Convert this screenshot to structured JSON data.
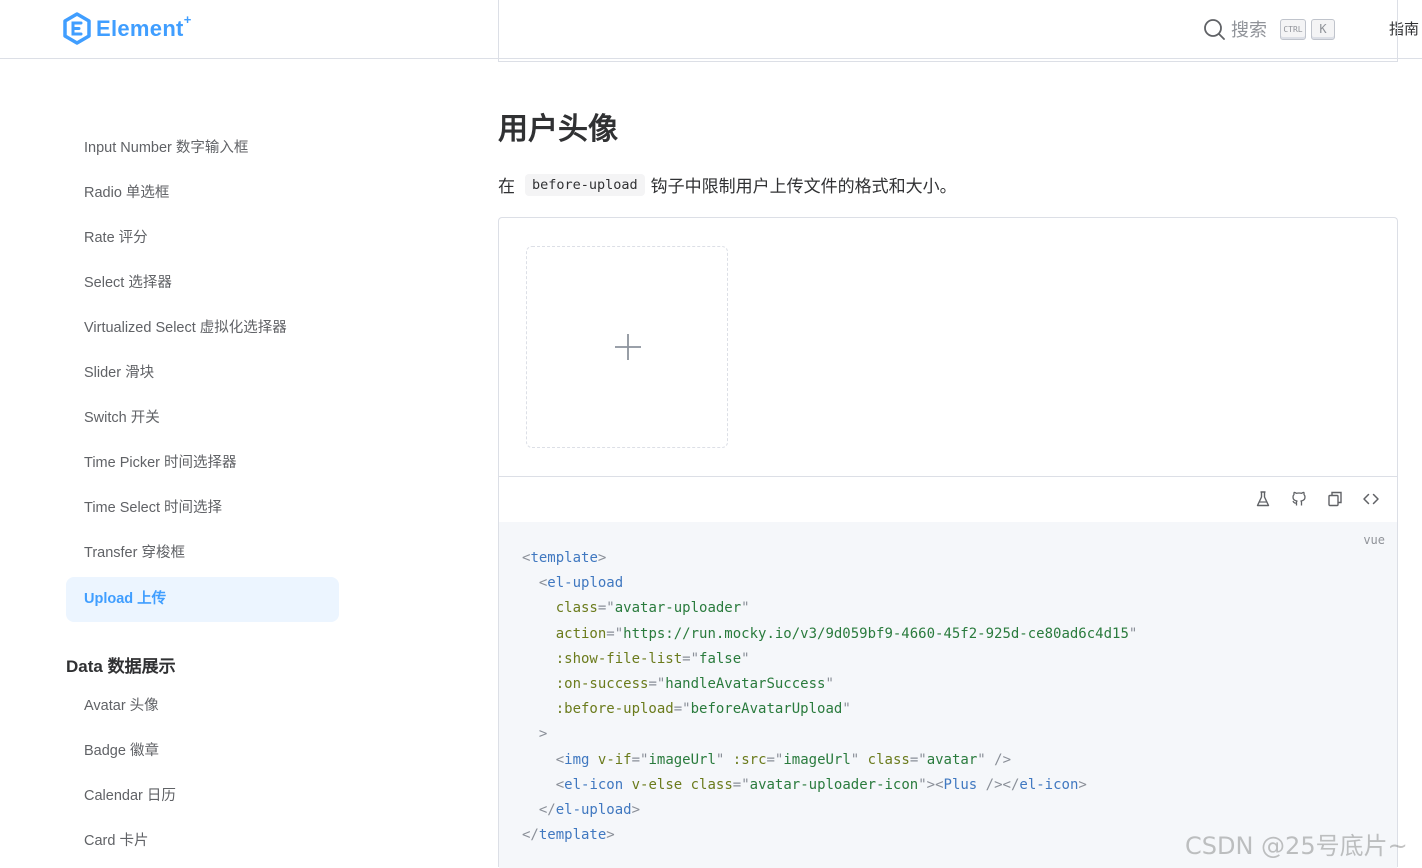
{
  "header": {
    "logo_text": "Element",
    "logo_plus": "+",
    "search_label": "搜索",
    "kbd_ctrl": "CTRL",
    "kbd_k": "K",
    "nav_guide": "指南"
  },
  "sidebar": {
    "items_form": [
      "Input Number 数字输入框",
      "Radio 单选框",
      "Rate 评分",
      "Select 选择器",
      "Virtualized Select 虚拟化选择器",
      "Slider 滑块",
      "Switch 开关",
      "Time Picker 时间选择器",
      "Time Select 时间选择",
      "Transfer 穿梭框",
      "Upload 上传"
    ],
    "group_data_title": "Data 数据展示",
    "items_data": [
      "Avatar 头像",
      "Badge 徽章",
      "Calendar 日历",
      "Card 卡片"
    ]
  },
  "main": {
    "section_title": "用户头像",
    "desc_prefix": "在",
    "desc_code": "before-upload",
    "desc_suffix": "钩子中限制用户上传文件的格式和大小。",
    "code_lang": "vue",
    "code": {
      "l1_tag": "template",
      "l2_tag": "el-upload",
      "l3_attr": "class",
      "l3_val": "avatar-uploader",
      "l4_attr": "action",
      "l4_val": "https://run.mocky.io/v3/9d059bf9-4660-45f2-925d-ce80ad6c4d15",
      "l5_attr": ":show-file-list",
      "l5_val": "false",
      "l6_attr": ":on-success",
      "l6_val": "handleAvatarSuccess",
      "l7_attr": ":before-upload",
      "l7_val": "beforeAvatarUpload",
      "l9_tag": "img",
      "l9_a1": "v-if",
      "l9_v1": "imageUrl",
      "l9_a2": ":src",
      "l9_v2": "imageUrl",
      "l9_a3": "class",
      "l9_v3": "avatar",
      "l10_tag": "el-icon",
      "l10_a1": "v-else",
      "l10_a2": "class",
      "l10_v2": "avatar-uploader-icon",
      "l10_inner": "Plus",
      "l10_close": "el-icon",
      "l11_close": "el-upload",
      "l12_close": "template"
    }
  },
  "watermark": "CSDN @25号底片~",
  "colors": {
    "accent": "#409eff",
    "active_bg": "#ecf5ff",
    "border": "#dcdfe6"
  }
}
